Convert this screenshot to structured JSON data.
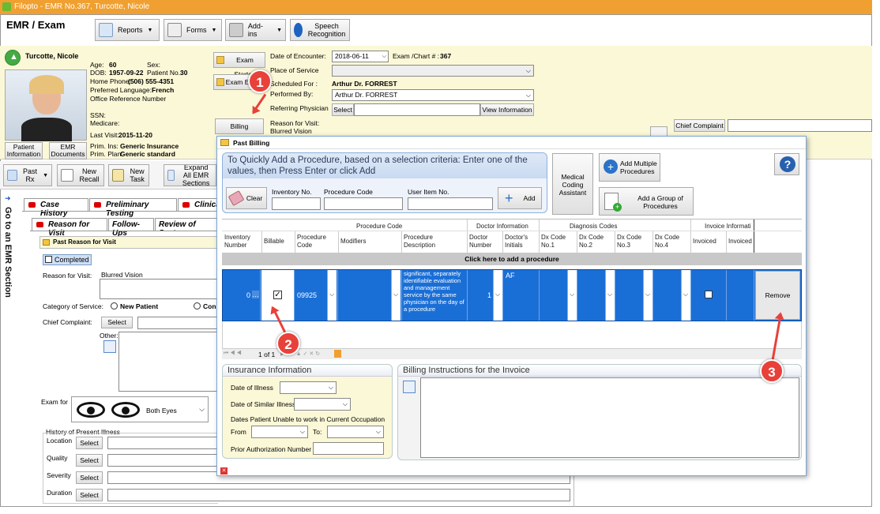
{
  "window": {
    "title": "Filopto - EMR No.367, Turcotte, Nicole"
  },
  "toolbar": {
    "heading": "EMR / Exam",
    "reports": "Reports",
    "forms": "Forms",
    "addins": "Add-ins",
    "speech": "Speech Recognition"
  },
  "patient": {
    "name": "Turcotte, Nicole",
    "age_label": "Age:",
    "age": "60",
    "sex_label": "Sex:",
    "dob_label": "DOB:",
    "dob": "1957-09-22",
    "patient_no_label": "Patient No.:",
    "patient_no": "30",
    "home_phone_label": "Home Phone:",
    "home_phone": "(506) 555-4351",
    "language_label": "Preferred Language:",
    "language": "French",
    "office_ref": "Office Reference Number",
    "ssn_label": "SSN:",
    "medicare_label": "Medicare:",
    "last_visit_label": "Last Visit:",
    "last_visit": "2015-11-20",
    "prim_ins_label": "Prim. Ins:",
    "prim_ins": "Generic Insurance",
    "prim_plan_label": "Prim. Plan:",
    "prim_plan": "Generic standard",
    "patient_info_btn": "Patient Information",
    "emr_docs_btn": "EMR Documents"
  },
  "encounter": {
    "exam_started": "Exam Started",
    "exam_ended": "Exam Ended",
    "billing": "Billing",
    "date_label": "Date of Encounter:",
    "date": "2018-06-11",
    "exam_chart_label": "Exam /Chart # :",
    "exam_chart": "367",
    "place_label": "Place of Service",
    "scheduled_label": "Scheduled For :",
    "scheduled": "Arthur Dr. FORREST",
    "performed_label": "Performed By:",
    "performed": "Arthur  Dr. FORREST",
    "referring_label": "Referring Physician",
    "select": "Select",
    "view_info": "View Information",
    "reason_label": "Reason for Visit:",
    "reason": "Blurred Vision",
    "chief_complaint": "Chief Complaint"
  },
  "left": {
    "past_rx": "Past Rx",
    "new_recall": "New Recall",
    "new_task": "New Task",
    "expand": "Expand All EMR Sections",
    "goto": "Go to an EMR Section",
    "tabs": [
      "Case History",
      "Preliminary Testing",
      "Clinical"
    ],
    "subtabs": [
      "Reason for Visit",
      "Follow-Ups",
      "Review of Systems"
    ],
    "past_reason": "Past Reason for Visit",
    "completed": "Completed",
    "reason_label": "Reason for Visit:",
    "reason_value": "Blurred Vision",
    "category_label": "Category of Service:",
    "new_patient": "New Patient",
    "con": "Con",
    "chief_label": "Chief Complaint:",
    "select": "Select",
    "other": "Other:",
    "exam_for": "Exam for",
    "both_eyes": "Both Eyes",
    "hpi": "History of Present Illness",
    "hpi_rows": [
      "Location",
      "Quality",
      "Severity",
      "Duration"
    ]
  },
  "dialog": {
    "title": "Past Billing",
    "quick_add": "To Quickly Add a Procedure, based on a selection criteria: Enter one of the values, then Press Enter or click Add",
    "clear": "Clear",
    "inventory_no": "Inventory No.",
    "procedure_code": "Procedure Code",
    "user_item": "User Item No.",
    "add": "Add",
    "med_coding": "Medical Coding Assistant",
    "add_multiple": "Add Multiple Procedures",
    "add_group": "Add a Group of Procedures",
    "groups": {
      "procedure": "Procedure Code",
      "doctor": "Doctor Information",
      "diagnosis": "Diagnosis Codes",
      "invoice": "Invoice Informati"
    },
    "columns": [
      "Inventory Number",
      "Billable",
      "Procedure Code",
      "Modifiers",
      "Procedure Description",
      "Doctor Number",
      "Doctor's Initials",
      "Dx Code No.1",
      "Dx Code No.2",
      "Dx Code No.3",
      "Dx Code No.4",
      "Invoiced",
      "Invoiced"
    ],
    "add_row": "Click here to add a procedure",
    "row": {
      "inventory": "0",
      "proc_code": "09925",
      "description": "significant, separately identifiable evaluation and management service by the same physician on the day of a procedure",
      "doctor_no": "1",
      "initials": "AF",
      "billable": true,
      "invoiced": false
    },
    "remove": "Remove",
    "pager": "1 of 1",
    "insurance_title": "Insurance Information",
    "date_illness": "Date of Illness",
    "date_similar": "Date of Similar Illness",
    "unable_work": "Dates Patient Unable to work in Current Occupation",
    "from": "From",
    "to": "To:",
    "prior_auth": "Prior Authorization Number",
    "billing_instr": "Billing Instructions for the Invoice"
  },
  "callouts": [
    "1",
    "2",
    "3"
  ],
  "colors": {
    "title_bar": "#f0a030",
    "selected_row": "#1a6fd6",
    "callout": "#e8413a",
    "patient_bg": "#fbf8d7"
  }
}
